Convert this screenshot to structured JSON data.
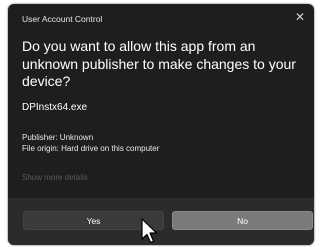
{
  "dialog": {
    "title": "User Account Control",
    "close_icon": "close-icon",
    "question": "Do you want to allow this app from an unknown publisher to make changes to your device?",
    "app_name": "DPInstx64.exe",
    "publisher": "Publisher: Unknown",
    "file_origin": "File origin: Hard drive on this computer",
    "show_more": "Show more details",
    "yes_label": "Yes",
    "no_label": "No"
  },
  "colors": {
    "dialog_bg": "#1e1e1e",
    "footer_bg": "#2b2b2b",
    "no_button_bg": "#7a7a7a"
  }
}
